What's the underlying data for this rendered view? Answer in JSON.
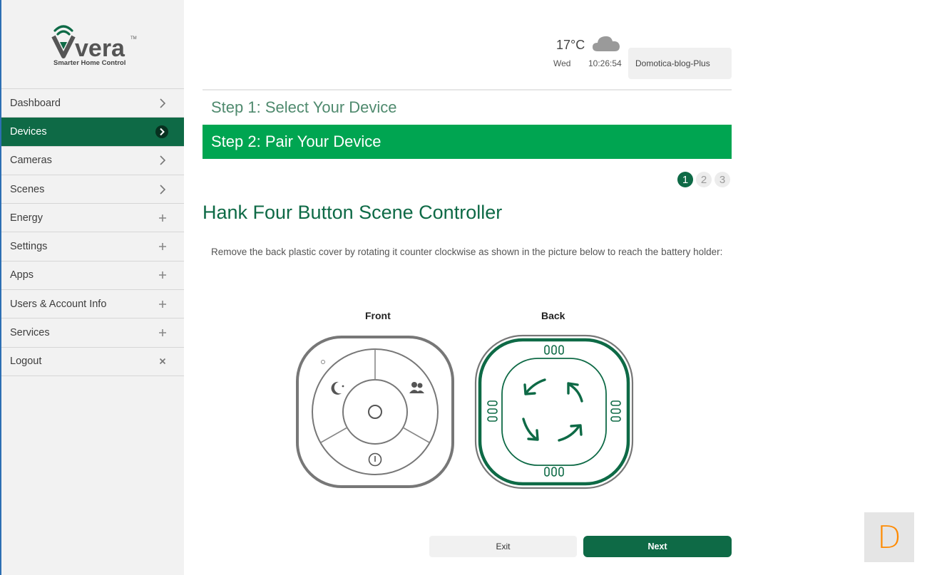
{
  "brand": {
    "name": "vera",
    "trademark": "TM",
    "tagline": "Smarter Home Control",
    "color": "#0e6a46"
  },
  "sidebar": {
    "items": [
      {
        "label": "Dashboard",
        "icon": "chevron-right-icon",
        "active": false
      },
      {
        "label": "Devices",
        "icon": "chevron-right-icon",
        "active": true
      },
      {
        "label": "Cameras",
        "icon": "chevron-right-icon",
        "active": false
      },
      {
        "label": "Scenes",
        "icon": "chevron-right-icon",
        "active": false
      },
      {
        "label": "Energy",
        "icon": "plus-icon",
        "active": false
      },
      {
        "label": "Settings",
        "icon": "plus-icon",
        "active": false
      },
      {
        "label": "Apps",
        "icon": "plus-icon",
        "active": false
      },
      {
        "label": "Users & Account Info",
        "icon": "plus-icon",
        "active": false
      },
      {
        "label": "Services",
        "icon": "plus-icon",
        "active": false
      },
      {
        "label": "Logout",
        "icon": "close-icon",
        "active": false
      }
    ]
  },
  "header": {
    "temperature": "17°C",
    "weather_icon": "cloud-icon",
    "day": "Wed",
    "time": "10:26:54",
    "controller_name": "Domotica-blog-Plus"
  },
  "wizard": {
    "step1": "Step 1: Select Your Device",
    "step2": "Step 2: Pair Your Device",
    "substeps": [
      "1",
      "2",
      "3"
    ],
    "current_substep": 1
  },
  "content": {
    "device_title": "Hank Four Button Scene Controller",
    "instruction": "Remove the back plastic cover by rotating it counter clockwise as shown in the picture below to reach the battery holder:",
    "front_label": "Front",
    "back_label": "Back"
  },
  "buttons": {
    "exit": "Exit",
    "next": "Next"
  },
  "corner_badge": {
    "letter": "D",
    "color": "#ff8a00"
  },
  "colors": {
    "accent_green": "#00a551",
    "dark_green": "#0e6a46",
    "sidebar_bg": "#f2f2f2"
  }
}
